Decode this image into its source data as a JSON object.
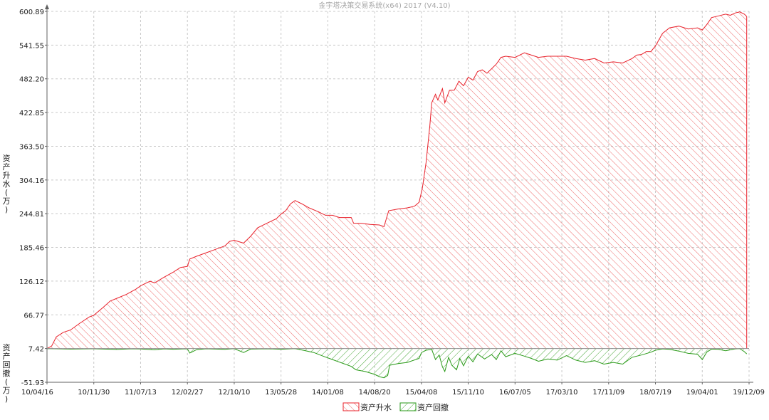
{
  "window": {
    "title": "金宇塔决策交易系统(x64) 2017 (V4.10)"
  },
  "colors": {
    "rise_stroke": "#e8202a",
    "rise_hatch": "#ee6a6a",
    "drawdown_stroke": "#2a9a18",
    "drawdown_hatch": "#4aa83a",
    "grid": "#c8c8c8",
    "axis": "#606060",
    "text": "#202020"
  },
  "chart_data": {
    "type": "area",
    "title": "",
    "ylabel_upper": "资产升水(万)",
    "ylabel_lower": "资产回撤(万)",
    "y_ticks": [
      "600.89",
      "541.55",
      "482.20",
      "422.85",
      "363.50",
      "304.16",
      "244.81",
      "185.46",
      "126.12",
      "66.77",
      "7.42",
      "-51.93"
    ],
    "ylim": [
      -51.93,
      600.89
    ],
    "baseline": 7.42,
    "x_ticks": [
      "10/04/16",
      "10/11/30",
      "11/07/13",
      "12/02/27",
      "12/10/10",
      "13/05/28",
      "14/01/08",
      "14/08/20",
      "15/04/08",
      "15/11/10",
      "16/07/05",
      "17/03/10",
      "17/11/09",
      "18/07/19",
      "19/04/01",
      "19/12/09"
    ],
    "grid": true,
    "legend_position": "bottom-center",
    "legend": [
      "资产升水",
      "资产回撤"
    ],
    "series": [
      {
        "name": "资产升水",
        "points": [
          [
            0,
            7.4
          ],
          [
            0.1,
            12
          ],
          [
            0.2,
            28
          ],
          [
            0.35,
            36
          ],
          [
            0.5,
            40
          ],
          [
            0.7,
            52
          ],
          [
            0.9,
            63
          ],
          [
            1.0,
            66
          ],
          [
            1.2,
            80
          ],
          [
            1.35,
            91
          ],
          [
            1.5,
            96
          ],
          [
            1.7,
            103
          ],
          [
            1.9,
            112
          ],
          [
            2.0,
            118
          ],
          [
            2.2,
            126
          ],
          [
            2.3,
            123
          ],
          [
            2.5,
            133
          ],
          [
            2.7,
            142
          ],
          [
            2.85,
            150
          ],
          [
            3.0,
            152
          ],
          [
            3.05,
            165
          ],
          [
            3.2,
            170
          ],
          [
            3.4,
            176
          ],
          [
            3.6,
            182
          ],
          [
            3.8,
            188
          ],
          [
            3.9,
            196
          ],
          [
            4.0,
            198
          ],
          [
            4.2,
            193
          ],
          [
            4.35,
            205
          ],
          [
            4.5,
            220
          ],
          [
            4.7,
            228
          ],
          [
            4.9,
            236
          ],
          [
            5.0,
            244
          ],
          [
            5.1,
            250
          ],
          [
            5.2,
            262
          ],
          [
            5.3,
            268
          ],
          [
            5.45,
            262
          ],
          [
            5.6,
            255
          ],
          [
            5.8,
            248
          ],
          [
            5.95,
            242
          ],
          [
            6.1,
            242
          ],
          [
            6.25,
            238
          ],
          [
            6.5,
            238
          ],
          [
            6.55,
            228
          ],
          [
            6.7,
            228
          ],
          [
            6.9,
            226
          ],
          [
            7.1,
            225
          ],
          [
            7.2,
            222
          ],
          [
            7.3,
            250
          ],
          [
            7.5,
            253
          ],
          [
            7.7,
            255
          ],
          [
            7.85,
            258
          ],
          [
            7.95,
            265
          ],
          [
            8.02,
            290
          ],
          [
            8.1,
            335
          ],
          [
            8.18,
            400
          ],
          [
            8.22,
            440
          ],
          [
            8.3,
            455
          ],
          [
            8.35,
            445
          ],
          [
            8.45,
            465
          ],
          [
            8.5,
            440
          ],
          [
            8.6,
            462
          ],
          [
            8.7,
            462
          ],
          [
            8.8,
            478
          ],
          [
            8.9,
            470
          ],
          [
            9.0,
            485
          ],
          [
            9.1,
            480
          ],
          [
            9.2,
            495
          ],
          [
            9.3,
            498
          ],
          [
            9.4,
            492
          ],
          [
            9.5,
            500
          ],
          [
            9.6,
            508
          ],
          [
            9.7,
            520
          ],
          [
            9.8,
            522
          ],
          [
            10.0,
            520
          ],
          [
            10.2,
            528
          ],
          [
            10.35,
            524
          ],
          [
            10.5,
            520
          ],
          [
            10.7,
            522
          ],
          [
            10.9,
            522
          ],
          [
            11.1,
            522
          ],
          [
            11.3,
            518
          ],
          [
            11.5,
            515
          ],
          [
            11.7,
            518
          ],
          [
            11.9,
            510
          ],
          [
            12.1,
            512
          ],
          [
            12.3,
            510
          ],
          [
            12.5,
            518
          ],
          [
            12.6,
            524
          ],
          [
            12.7,
            525
          ],
          [
            12.8,
            530
          ],
          [
            12.9,
            530
          ],
          [
            13.0,
            540
          ],
          [
            13.15,
            562
          ],
          [
            13.3,
            572
          ],
          [
            13.5,
            575
          ],
          [
            13.7,
            570
          ],
          [
            13.9,
            572
          ],
          [
            14.0,
            568
          ],
          [
            14.1,
            578
          ],
          [
            14.2,
            590
          ],
          [
            14.35,
            593
          ],
          [
            14.5,
            596
          ],
          [
            14.6,
            594
          ],
          [
            14.7,
            598
          ],
          [
            14.8,
            600
          ],
          [
            14.9,
            596
          ],
          [
            14.95,
            592
          ]
        ]
      },
      {
        "name": "资产回撤",
        "points": [
          [
            0,
            7.4
          ],
          [
            0.5,
            6.5
          ],
          [
            1.0,
            7.0
          ],
          [
            1.5,
            5.8
          ],
          [
            1.8,
            7.0
          ],
          [
            2.0,
            6.6
          ],
          [
            2.3,
            5.2
          ],
          [
            2.5,
            6.8
          ],
          [
            2.7,
            6.2
          ],
          [
            3.0,
            6.9
          ],
          [
            3.05,
            -0.5
          ],
          [
            3.2,
            5.6
          ],
          [
            3.4,
            7.0
          ],
          [
            3.8,
            6.0
          ],
          [
            4.0,
            7.2
          ],
          [
            4.2,
            0.5
          ],
          [
            4.35,
            6.5
          ],
          [
            4.7,
            6.9
          ],
          [
            5.0,
            6.2
          ],
          [
            5.3,
            7.3
          ],
          [
            5.5,
            4.0
          ],
          [
            5.7,
            0.5
          ],
          [
            5.9,
            -6.0
          ],
          [
            6.1,
            -12.0
          ],
          [
            6.3,
            -18.0
          ],
          [
            6.5,
            -24.0
          ],
          [
            6.6,
            -30.0
          ],
          [
            6.8,
            -33.0
          ],
          [
            7.0,
            -38.0
          ],
          [
            7.1,
            -42.0
          ],
          [
            7.2,
            -44.0
          ],
          [
            7.28,
            -40.0
          ],
          [
            7.32,
            -22.0
          ],
          [
            7.5,
            -19.0
          ],
          [
            7.7,
            -17.0
          ],
          [
            7.95,
            -10.0
          ],
          [
            8.0,
            0.5
          ],
          [
            8.1,
            4.5
          ],
          [
            8.22,
            6.0
          ],
          [
            8.3,
            -12.0
          ],
          [
            8.38,
            -4.0
          ],
          [
            8.45,
            -25.0
          ],
          [
            8.5,
            -33.0
          ],
          [
            8.58,
            -8.0
          ],
          [
            8.65,
            -22.0
          ],
          [
            8.75,
            -30.0
          ],
          [
            8.82,
            -10.0
          ],
          [
            8.9,
            -23.0
          ],
          [
            9.0,
            -6.0
          ],
          [
            9.1,
            -16.0
          ],
          [
            9.2,
            -2.0
          ],
          [
            9.35,
            -11.0
          ],
          [
            9.5,
            -3.0
          ],
          [
            9.6,
            -12.0
          ],
          [
            9.7,
            3.5
          ],
          [
            9.8,
            -7.0
          ],
          [
            10.0,
            -1.0
          ],
          [
            10.2,
            -6.0
          ],
          [
            10.35,
            -10.0
          ],
          [
            10.5,
            -15.0
          ],
          [
            10.7,
            -11.0
          ],
          [
            10.9,
            -13.0
          ],
          [
            11.1,
            -5.0
          ],
          [
            11.3,
            -13.0
          ],
          [
            11.5,
            -17.0
          ],
          [
            11.7,
            -14.0
          ],
          [
            11.9,
            -20.0
          ],
          [
            12.1,
            -17.0
          ],
          [
            12.3,
            -20.0
          ],
          [
            12.5,
            -8.0
          ],
          [
            12.7,
            -4.0
          ],
          [
            12.9,
            1.0
          ],
          [
            13.0,
            4.5
          ],
          [
            13.15,
            6.8
          ],
          [
            13.3,
            6.0
          ],
          [
            13.5,
            3.0
          ],
          [
            13.7,
            -1.0
          ],
          [
            13.9,
            -2.5
          ],
          [
            14.0,
            -12.0
          ],
          [
            14.1,
            1.5
          ],
          [
            14.2,
            6.5
          ],
          [
            14.35,
            6.0
          ],
          [
            14.5,
            3.5
          ],
          [
            14.7,
            6.8
          ],
          [
            14.8,
            7.3
          ],
          [
            14.9,
            2.0
          ],
          [
            14.95,
            -2.0
          ]
        ]
      }
    ]
  }
}
